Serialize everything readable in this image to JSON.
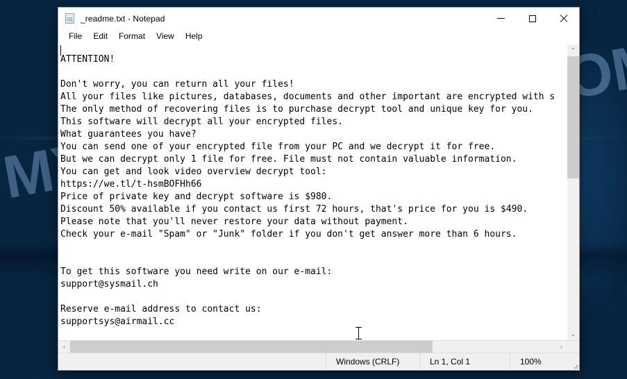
{
  "window": {
    "title": "_readme.txt - Notepad",
    "icon": "notepad-icon",
    "controls": {
      "minimize": "Minimize",
      "maximize": "Maximize",
      "close": "Close"
    }
  },
  "menu": {
    "items": [
      {
        "label": "File"
      },
      {
        "label": "Edit"
      },
      {
        "label": "Format"
      },
      {
        "label": "View"
      },
      {
        "label": "Help"
      }
    ]
  },
  "document": {
    "filename": "_readme.txt",
    "body": "ATTENTION!\n\nDon't worry, you can return all your files!\nAll your files like pictures, databases, documents and other important are encrypted with s\nThe only method of recovering files is to purchase decrypt tool and unique key for you.\nThis software will decrypt all your encrypted files.\nWhat guarantees you have?\nYou can send one of your encrypted file from your PC and we decrypt it for free.\nBut we can decrypt only 1 file for free. File must not contain valuable information.\nYou can get and look video overview decrypt tool:\nhttps://we.tl/t-hsmBOFHh66\nPrice of private key and decrypt software is $980.\nDiscount 50% available if you contact us first 72 hours, that's price for you is $490.\nPlease note that you'll never restore your data without payment.\nCheck your e-mail \"Spam\" or \"Junk\" folder if you don't get answer more than 6 hours.\n\n\nTo get this software you need write on our e-mail:\nsupport@sysmail.ch\n\nReserve e-mail address to contact us:\nsupportsys@airmail.cc\n\nYour personal ID:",
    "details": {
      "video_url": "https://we.tl/t-hsmBOFHh66",
      "price": "$980",
      "discount_price": "$490",
      "discount_percent": "50%",
      "discount_window": "72 hours",
      "response_time": "6 hours",
      "primary_email": "support@sysmail.ch",
      "reserve_email": "supportsys@airmail.cc"
    }
  },
  "scrollbars": {
    "vertical": {
      "up_arrow": "⌃",
      "down_arrow": "⌄"
    },
    "horizontal": {
      "left_arrow": "‹",
      "right_arrow": "›"
    }
  },
  "status_bar": {
    "encoding": "Windows (CRLF)",
    "position": "Ln 1, Col 1",
    "zoom": "100%"
  },
  "desktop": {
    "watermark": "MYANTISPYWARE.COM"
  },
  "colors": {
    "wallpaper": "#072441",
    "window_chrome": "#ffffff",
    "status_bar": "#f0f0f0",
    "scrollbar_thumb": "#cdcdcd",
    "text": "#000000",
    "watermark": "#96bee b"
  }
}
